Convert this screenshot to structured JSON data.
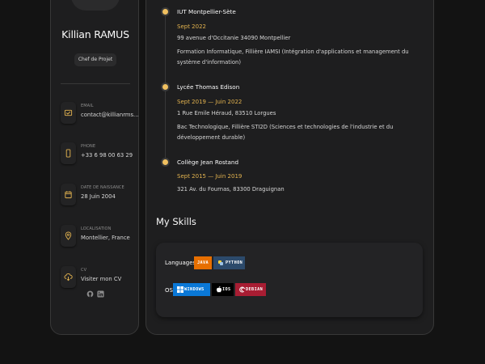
{
  "profile": {
    "name": "Killian RAMUS",
    "role": "Chef de Projet"
  },
  "contacts": [
    {
      "icon": "mail-icon",
      "title": "EMAIL",
      "value": "contact@killianrms..."
    },
    {
      "icon": "phone-icon",
      "title": "PHONE",
      "value": "+33 6 98 00 63 29"
    },
    {
      "icon": "calendar-icon",
      "title": "DATE DE NAISSANCE",
      "value": "28 Juin 2004"
    },
    {
      "icon": "location-icon",
      "title": "LOCALISATION",
      "value": "Montellier, France"
    },
    {
      "icon": "cloud-download-icon",
      "title": "CV",
      "value": "Visiter mon CV"
    }
  ],
  "social": [
    "github-icon",
    "linkedin-icon"
  ],
  "education": [
    {
      "school": "IUT Montpellier-Sète",
      "date": "Sept 2022",
      "lines": [
        "99 avenue d'Occitanie 34090 Montpellier",
        "Formation Informatique, Fillière IAMSI (Intégration d'applications et management du système d'information)"
      ]
    },
    {
      "school": "Lycée Thomas Edison",
      "date": "Sept 2019 — Juin 2022",
      "lines": [
        "1 Rue Emile Héraud, 83510 Lorgues",
        "Bac Technologique, Fillière STI2D (Sciences et technologies de l'industrie et du développement durable)"
      ]
    },
    {
      "school": "Collège Jean Rostand",
      "date": "Sept 2015 — Juin 2019",
      "lines": [
        "321 Av. du Fournas, 83300 Draguignan"
      ]
    }
  ],
  "skills": {
    "heading": "My Skills",
    "languages_label": "Languages",
    "os_label": "OS",
    "languages": [
      {
        "label": "JAVA",
        "color": "#e76f00"
      },
      {
        "label": "PYTHON",
        "color": "#2c4a6b",
        "icon": "python-icon"
      }
    ],
    "os": [
      {
        "label": "WINDOWS",
        "color": "#0a78d7",
        "icon": "windows-icon"
      },
      {
        "label": "IOS",
        "color": "#000000",
        "icon": "apple-icon"
      },
      {
        "label": "DEBIAN",
        "color": "#a81d33",
        "icon": "debian-icon"
      }
    ]
  },
  "colors": {
    "accent": "#e3b34f",
    "panel": "#1e1e1f",
    "background": "#131313"
  }
}
